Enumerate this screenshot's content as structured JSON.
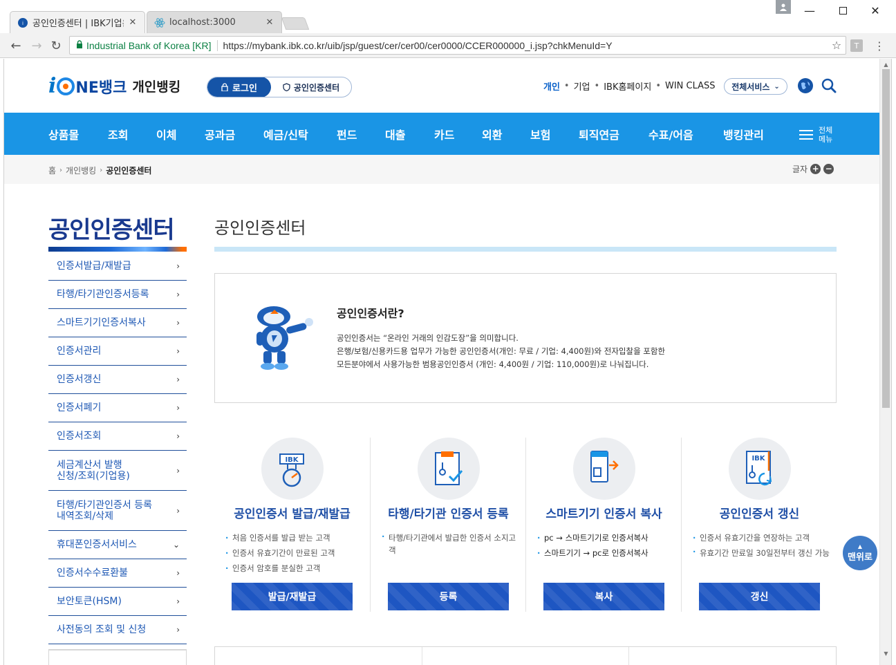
{
  "browser": {
    "tabs": [
      {
        "title": "공인인증센터 | IBK기업은",
        "active": true
      },
      {
        "title": "localhost:3000",
        "active": false
      }
    ],
    "secure_label": "Industrial Bank of Korea [KR]",
    "url": "https://mybank.ibk.co.kr/uib/jsp/guest/cer/cer00/cer0000/CCER000000_i.jsp?chkMenuId=Y",
    "extension_label": "T"
  },
  "header": {
    "logo_i": "i",
    "logo_ne": "NE뱅크",
    "logo_personal": "개인뱅킹",
    "login": "로그인",
    "cert_center": "공인인증센터",
    "links": [
      "개인",
      "기업",
      "IBK홈페이지",
      "WIN CLASS"
    ],
    "all_service": "전체서비스"
  },
  "gnb": {
    "items": [
      "상품몰",
      "조회",
      "이체",
      "공과금",
      "예금/신탁",
      "펀드",
      "대출",
      "카드",
      "외환",
      "보험",
      "퇴직연금",
      "수표/어음",
      "뱅킹관리"
    ],
    "all_menu": "전체 메뉴"
  },
  "breadcrumb": {
    "items": [
      "홈",
      "개인뱅킹",
      "공인인증센터"
    ],
    "font_label": "글자"
  },
  "lnb": {
    "title": "공인인증센터",
    "items": [
      {
        "label": "인증서발급/재발급",
        "chev": "›"
      },
      {
        "label": "타행/타기관인증서등록",
        "chev": "›"
      },
      {
        "label": "스마트기기인증서복사",
        "chev": "›"
      },
      {
        "label": "인증서관리",
        "chev": "›"
      },
      {
        "label": "인증서갱신",
        "chev": "›"
      },
      {
        "label": "인증서폐기",
        "chev": "›"
      },
      {
        "label": "인증서조회",
        "chev": "›"
      },
      {
        "label": "세금계산서 발행\n신청/조회(기업용)",
        "chev": "›"
      },
      {
        "label": "타행/타기관인증서 등록\n내역조회/삭제",
        "chev": "›"
      },
      {
        "label": "휴대폰인증서서비스",
        "chev": "⌄"
      },
      {
        "label": "인증서수수료환불",
        "chev": "›"
      },
      {
        "label": "보안토큰(HSM)",
        "chev": "›"
      },
      {
        "label": "사전동의 조회 및 신청",
        "chev": "›"
      }
    ]
  },
  "content": {
    "title": "공인인증센터",
    "intro_question": "공인인증서란?",
    "intro_lines": [
      "공인인증서는 “온라인 거래의 인감도장”을 의미합니다.",
      "은행/보험/신용카드용 업무가 가능한 공인인증서(개인: 무료 / 기업: 4,400원)와 전자입찰을 포함한",
      "모든분야에서 사용가능한 범용공인인증서 (개인: 4,400원 / 기업: 110,000원)로 나눠집니다."
    ],
    "services": [
      {
        "title": "공인인증서 발급/재발급",
        "desc": [
          "처음 인증서를 발급 받는 고객",
          "인증서 유효기간이 만료된 고객",
          "인증서 암호를 분실한 고객"
        ],
        "button": "발급/재발급",
        "icon": "ibk-certificate-icon"
      },
      {
        "title": "타행/타기관 인증서 등록",
        "desc": [
          "타행/타기관에서 발급한 인증서 소지고객"
        ],
        "button": "등록",
        "icon": "register-certificate-icon"
      },
      {
        "title": "스마트기기 인증서 복사",
        "desc": [
          "pc → 스마트기기로 인증서복사",
          "스마트기기 → pc로 인증서복사"
        ],
        "button": "복사",
        "icon": "copy-device-icon"
      },
      {
        "title": "공인인증서 갱신",
        "desc": [
          "인증서 유효기간을 연장하는 고객",
          "유효기간 만료일 30일전부터 갱신 가능"
        ],
        "button": "갱신",
        "icon": "renew-certificate-icon"
      }
    ]
  },
  "top_button": "맨위로",
  "colors": {
    "gnb": "#1a95e5",
    "brand_navy": "#1a3a8f",
    "button_blue": "#1e56c2",
    "accent_orange": "#ff6f00"
  }
}
